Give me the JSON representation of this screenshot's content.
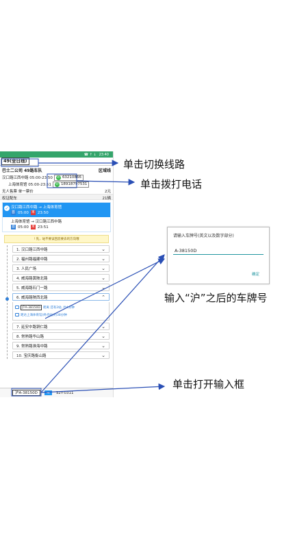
{
  "status_bar": {
    "time": "23:40",
    "icons": "☎ ↑ ↓"
  },
  "route": {
    "name": "49(全日线)"
  },
  "company": {
    "name": "巴士二公司 49路车队",
    "type": "区域线"
  },
  "terminals": [
    {
      "text": "汉口路江西中路 05:00-23:50",
      "phone": "63210866"
    },
    {
      "text": "上海体育馆 05:00-23:51",
      "phone": "18918797531"
    }
  ],
  "details": [
    {
      "label": "无人售票 单一票价",
      "value": "2元"
    },
    {
      "label": "权证配车",
      "value": "21辆"
    }
  ],
  "direction": {
    "current": "汉口路江西中路 → 上海体育馆",
    "current_start": "05:00",
    "current_end": "23:50",
    "other": "上海体育馆 → 汉口路江西中路",
    "other_start": "05:00",
    "other_end": "23:51",
    "start_badge": "首",
    "end_badge": "末"
  },
  "tip": "! 先，站不要误回您要去的方向哦",
  "stops": [
    "1. 汉口路江西中路",
    "2. 福州路福建中路",
    "3. 人民广场",
    "4. 威海路黄陂北路",
    "5. 威海路石门一路",
    "6. 威海路陕西北路",
    "7. 延安中路铜仁路",
    "8. 常熟路华山路",
    "9. 常熟路淮海中路",
    "10. 宝庆路衡山路"
  ],
  "arrival": {
    "plate": "沪A-38150D",
    "line1": "距离 还有2站, 约4分钟",
    "line2": "距达上海体育馆(终点站)约38分钟"
  },
  "bottom": {
    "plate": "沪A-38150D",
    "next_plate": "S2Y-0311"
  },
  "dialog": {
    "title": "请输入车牌号(英文以及数字部分)",
    "value": "A-38150D",
    "ok": "确定"
  },
  "annotations": {
    "switch_route": "单击切换线路",
    "dial_phone": "单击拨打电话",
    "enter_plate": "输入“沪”之后的车牌号",
    "open_input": "单击打开输入框"
  }
}
